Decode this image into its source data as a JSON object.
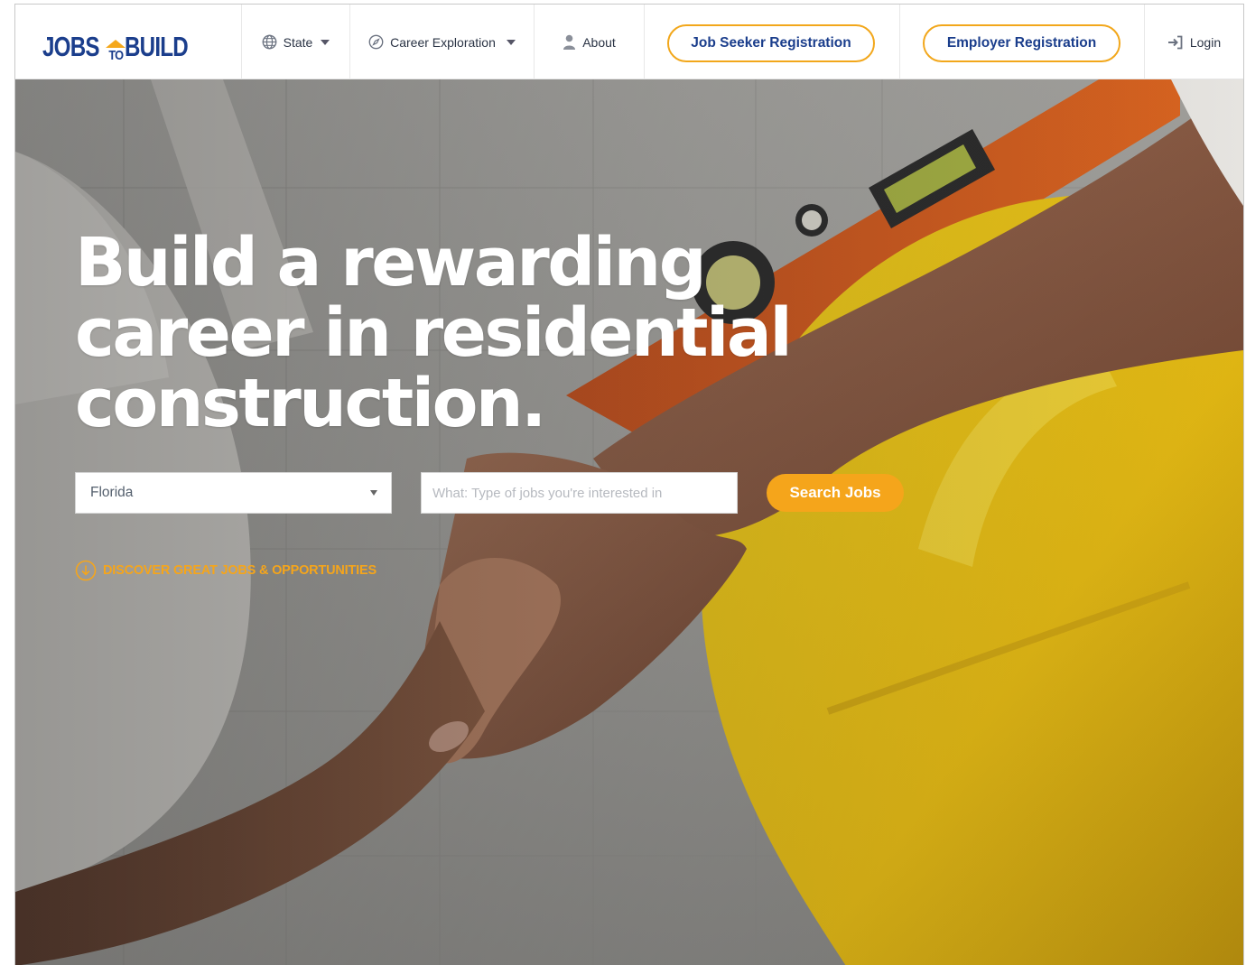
{
  "header": {
    "logo": {
      "jobs": "JOBS",
      "to": "TO",
      "build": "BUILD"
    },
    "nav": [
      {
        "label": "State",
        "icon": "globe-icon",
        "has_dropdown": true
      },
      {
        "label": "Career Exploration",
        "icon": "compass-icon",
        "has_dropdown": true
      },
      {
        "label": "About",
        "icon": "person-icon",
        "has_dropdown": false
      }
    ],
    "job_seeker_label": "Job Seeker Registration",
    "employer_label": "Employer Registration",
    "login_label": "Login",
    "login_icon": "login-arrow-icon"
  },
  "hero": {
    "headline_lines": [
      "Build a rewarding",
      "career in residential",
      "construction."
    ],
    "state_select_value": "Florida",
    "what_placeholder": "What: Type of jobs you're interested in",
    "search_button_label": "Search Jobs",
    "discover_label": "DISCOVER GREAT JOBS & OPPORTUNITIES",
    "discover_icon": "arrow-down-circle-icon"
  },
  "colors": {
    "brand_blue": "#1b3e8c",
    "accent_orange": "#f5a51b"
  }
}
